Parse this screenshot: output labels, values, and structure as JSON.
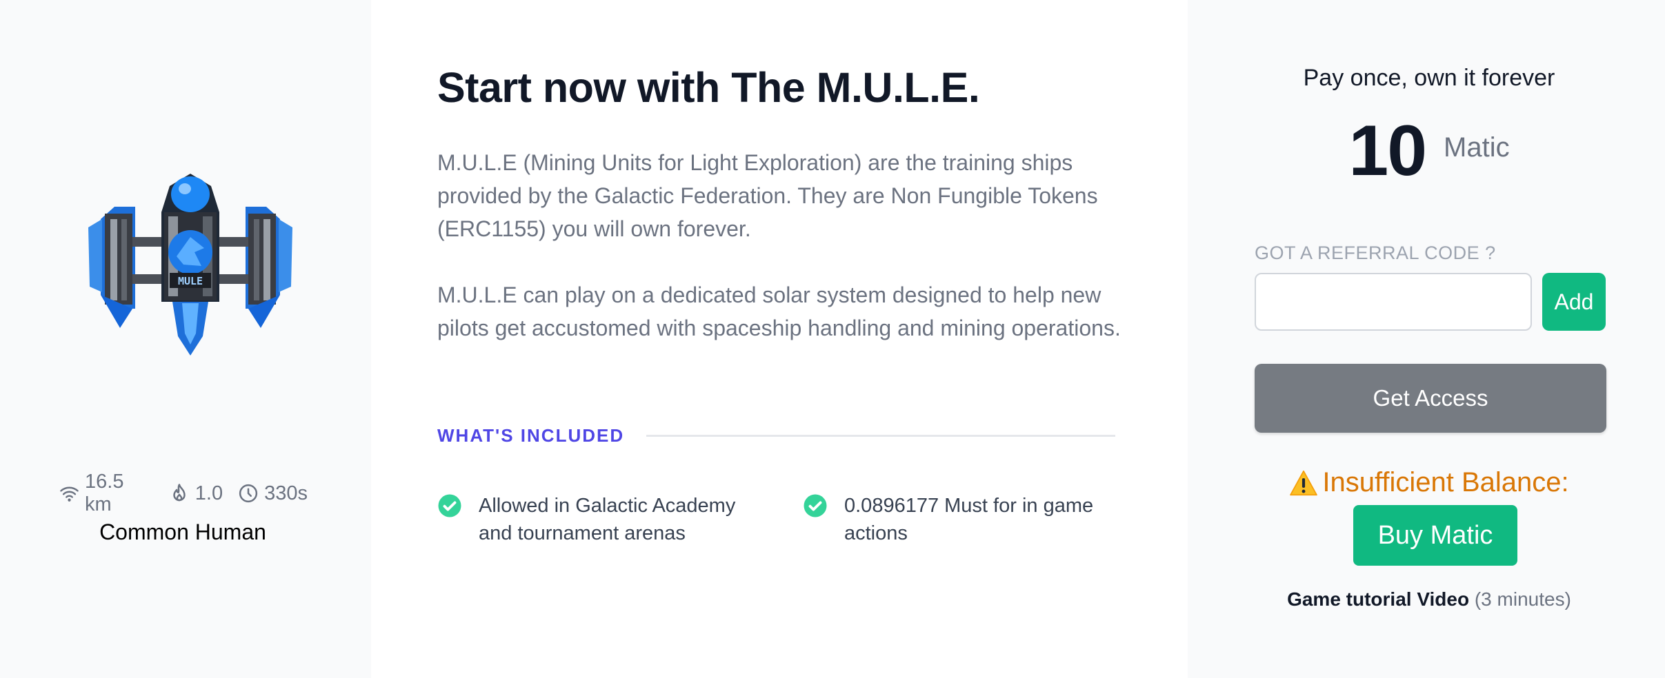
{
  "ship": {
    "badge_text": "MULE",
    "stats": {
      "range": "16.5 km",
      "fuel": "1.0",
      "time": "330s"
    },
    "class": "Common Human"
  },
  "main": {
    "title": "Start now with The M.U.L.E.",
    "paragraph1": "M.U.L.E (Mining Units for Light Exploration) are the training ships provided by the Galactic Federation. They are Non Fungible Tokens (ERC1155) you will own forever.",
    "paragraph2": "M.U.L.E can play on a dedicated solar system designed to help new pilots get accustomed with spaceship handling and mining operations.",
    "included_label": "WHAT'S INCLUDED",
    "features": [
      "Allowed in Galactic Academy and tournament arenas",
      "0.0896177 Must for in game actions"
    ]
  },
  "purchase": {
    "pay_text": "Pay once, own it forever",
    "price": "10",
    "currency": "Matic",
    "referral_label": "GOT A REFERRAL CODE ?",
    "referral_value": "",
    "add_label": "Add",
    "access_label": "Get Access",
    "warning": "Insufficient Balance:",
    "buy_label": "Buy Matic",
    "tutorial_link": "Game tutorial Video",
    "tutorial_duration": "(3 minutes)"
  },
  "colors": {
    "accent": "#4f46e5",
    "success": "#10b981",
    "warning": "#d97706",
    "disabled_button": "#767b82"
  }
}
